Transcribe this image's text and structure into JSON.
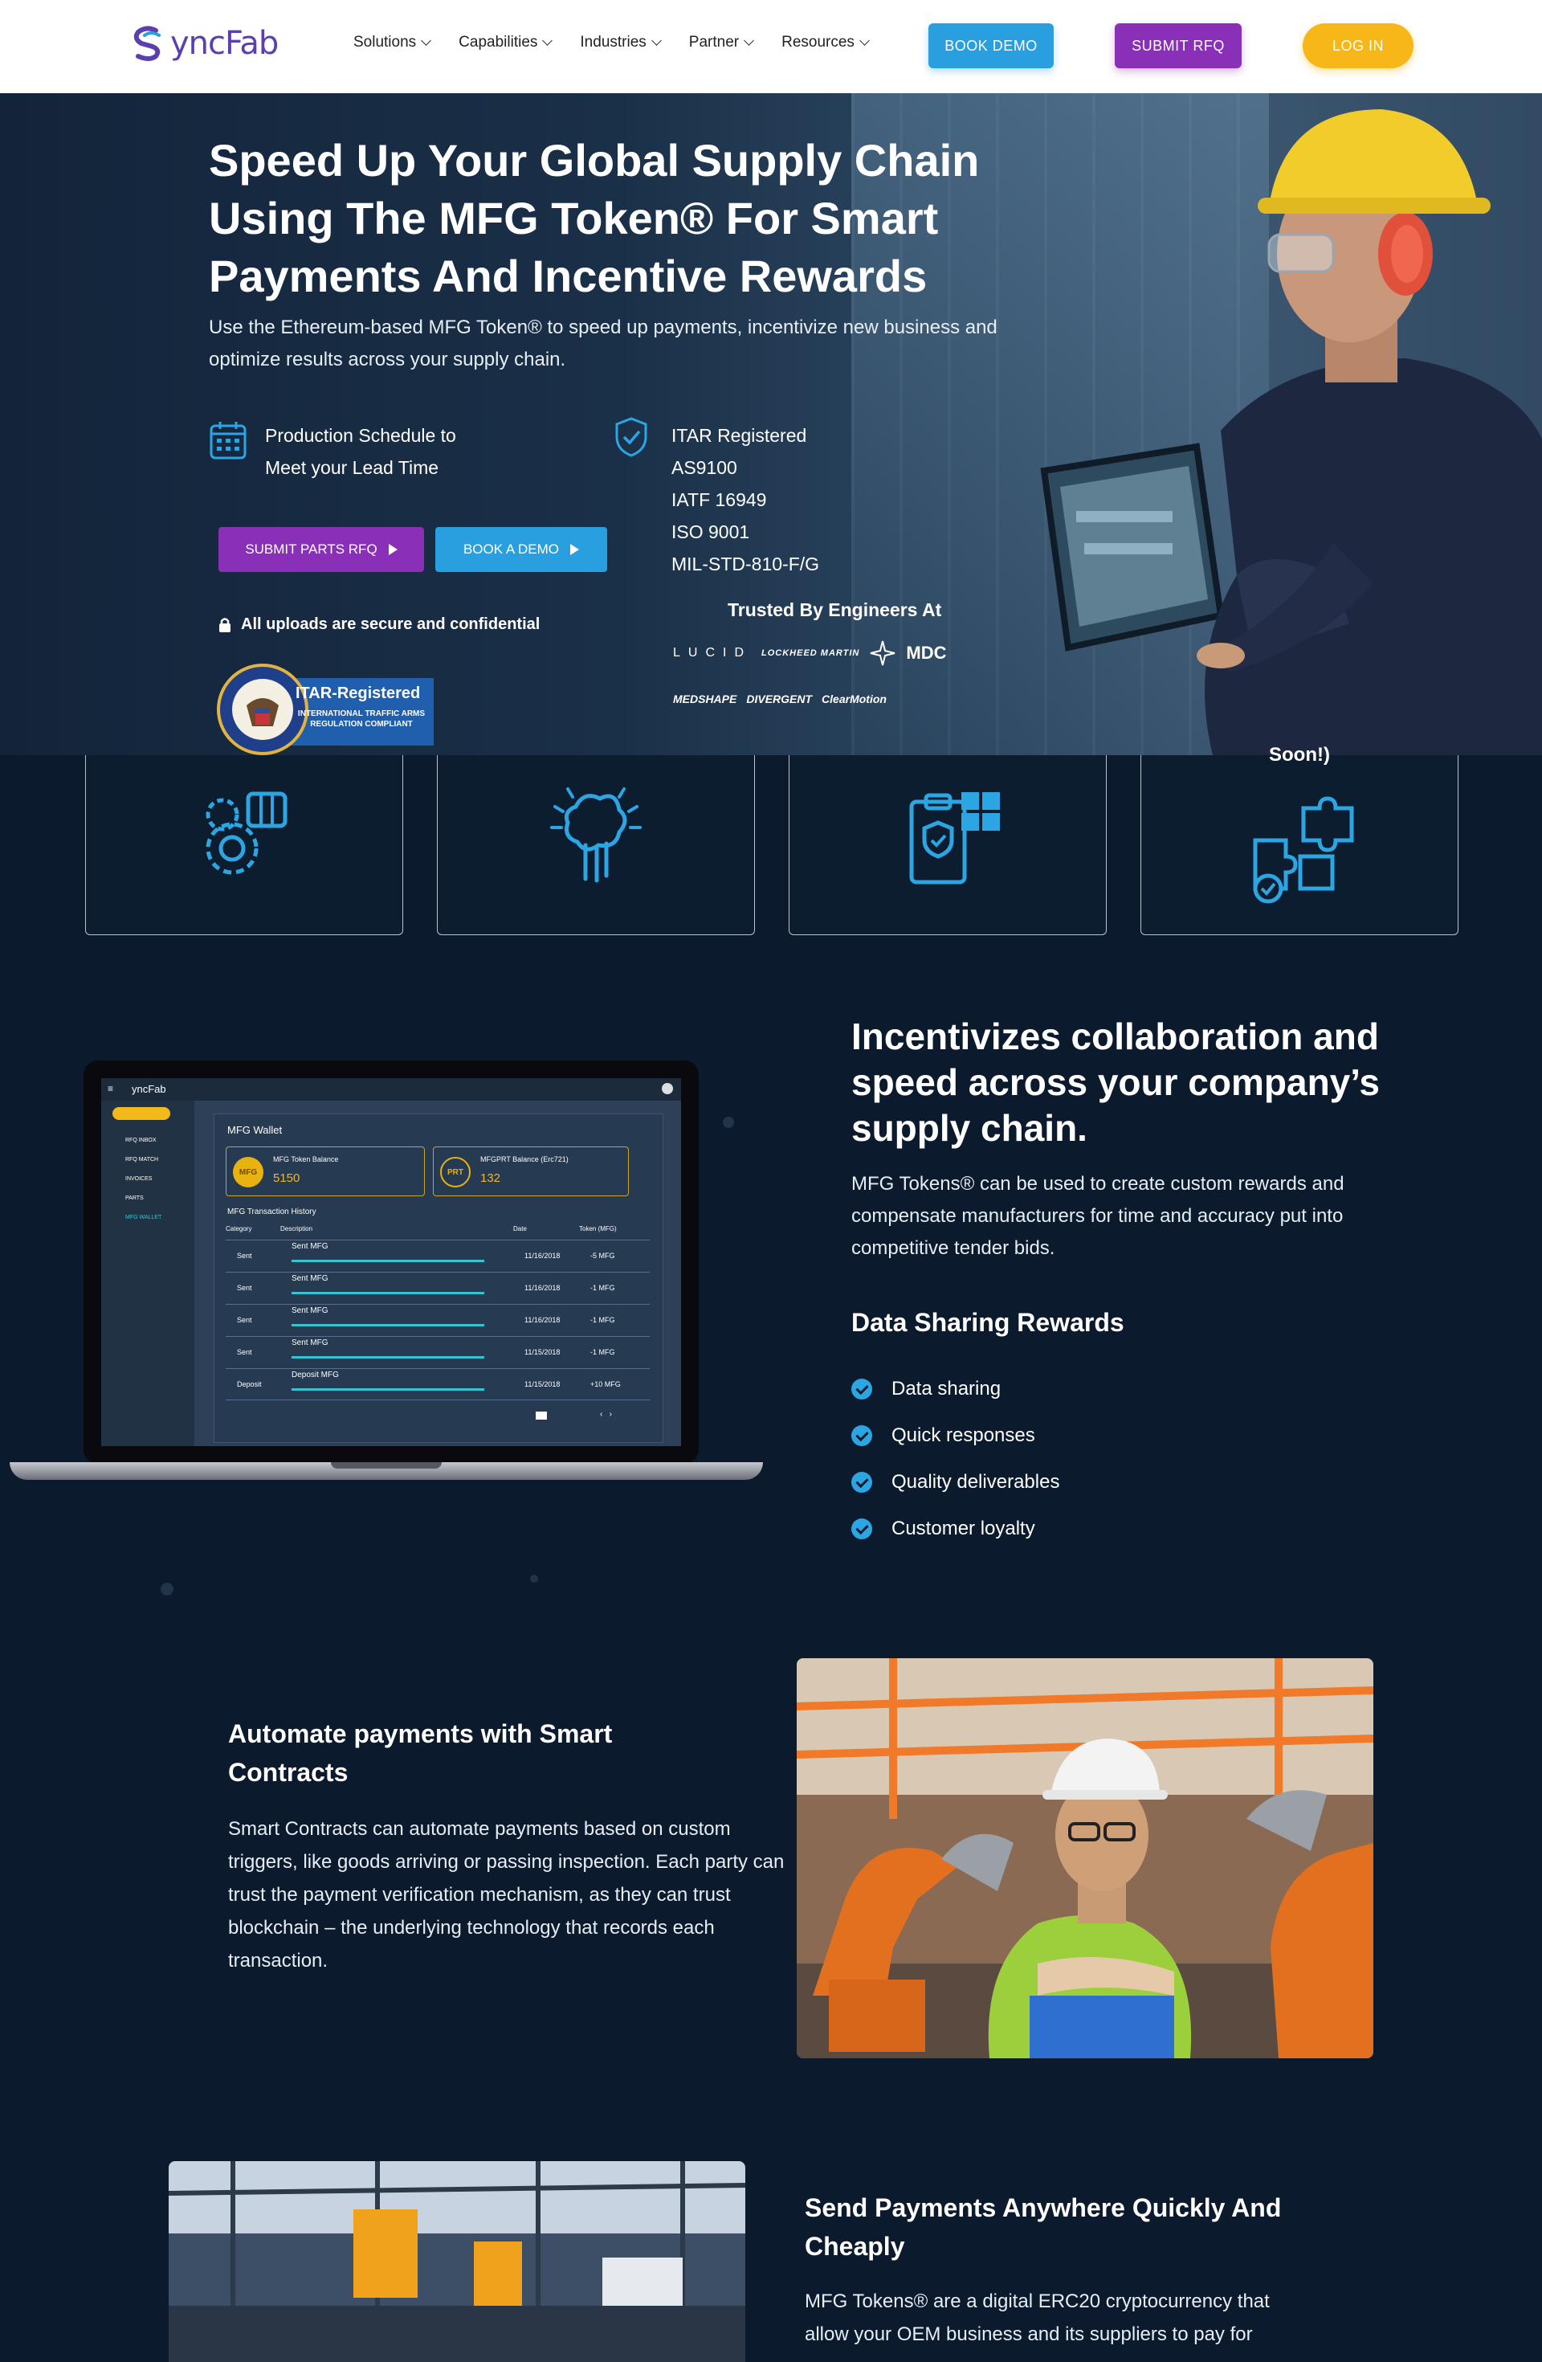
{
  "nav": {
    "logo_text": "yncFab",
    "menu": [
      {
        "label": "Solutions"
      },
      {
        "label": "Capabilities"
      },
      {
        "label": "Industries"
      },
      {
        "label": "Partner"
      },
      {
        "label": "Resources"
      }
    ],
    "book_demo": "BOOK DEMO",
    "submit_rfq": "SUBMIT RFQ",
    "login": "LOG IN"
  },
  "hero": {
    "title": "Speed Up Your Global Supply Chain Using The MFG Token® For Smart Payments And Incentive Rewards",
    "subtitle": "Use the Ethereum-based MFG Token® to speed up payments, incentivize new business and optimize results across your supply chain.",
    "feature_schedule": "Production Schedule to\nMeet your Lead Time",
    "certifications": [
      "ITAR Registered",
      "AS9100",
      "IATF 16949",
      "ISO 9001",
      "MIL-STD-810-F/G"
    ],
    "btn_parts_rfq": "SUBMIT PARTS RFQ",
    "btn_book_demo": "BOOK A DEMO",
    "secure_note": "All uploads are secure and confidential",
    "itar_badge": {
      "title": "ITAR-Registered",
      "subtitle": "INTERNATIONAL TRAFFIC ARMS REGULATION COMPLIANT"
    },
    "trusted_by": "Trusted By Engineers At",
    "logos_row1": [
      "LUCID",
      "LOCKHEED MARTIN",
      "MDC"
    ],
    "logos_row2": [
      "MEDSHAPE",
      "DIVERGENT",
      "ClearMotion"
    ]
  },
  "cards": [
    {
      "text": "",
      "icon": "gear-machine-icon"
    },
    {
      "text": "",
      "icon": "brain-hand-icon"
    },
    {
      "text": "",
      "icon": "clipboard-shield-icon"
    },
    {
      "text": "Soon!)",
      "icon": "puzzle-check-icon"
    }
  ],
  "wallet": {
    "app_logo": "yncFab",
    "sidebar": [
      "",
      "RFQ INBOX",
      "RFQ MATCH",
      "INVOICES",
      "PARTS",
      "MFG WALLET"
    ],
    "title": "MFG Wallet",
    "token_balance_label": "MFG Token Balance",
    "token_balance": "5150",
    "prt_balance_label": "MFGPRT Balance (Erc721)",
    "prt_balance": "132",
    "history_title": "MFG Transaction History",
    "columns": [
      "Category",
      "Description",
      "Date",
      "Token (MFG)"
    ],
    "rows": [
      {
        "category": "Sent",
        "description": "Sent MFG",
        "date": "11/16/2018",
        "amount": "-5 MFG"
      },
      {
        "category": "Sent",
        "description": "Sent MFG",
        "date": "11/16/2018",
        "amount": "-1 MFG"
      },
      {
        "category": "Sent",
        "description": "Sent MFG",
        "date": "11/16/2018",
        "amount": "-1 MFG"
      },
      {
        "category": "Sent",
        "description": "Sent MFG",
        "date": "11/15/2018",
        "amount": "-1 MFG"
      },
      {
        "category": "Deposit",
        "description": "Deposit MFG",
        "date": "11/15/2018",
        "amount": "+10 MFG"
      }
    ]
  },
  "incentive": {
    "title": "Incentivizes collaboration and speed across your company’s supply chain.",
    "body": "MFG Tokens® can be used to create custom rewards and compensate manufacturers for time and accuracy put into competitive tender bids.",
    "rewards_title": "Data Sharing Rewards",
    "rewards": [
      "Data sharing",
      "Quick responses",
      "Quality deliverables",
      "Customer loyalty"
    ]
  },
  "automate": {
    "title": "Automate payments with Smart Contracts",
    "body": "Smart Contracts can automate payments based on custom triggers, like goods arriving or passing inspection. Each party can trust the payment verification mechanism, as they can trust blockchain – the underlying technology that records each transaction."
  },
  "send": {
    "title": "Send Payments Anywhere Quickly And Cheaply",
    "body": "MFG Tokens® are a digital ERC20 cryptocurrency that allow your OEM business and its suppliers to pay for"
  },
  "colors": {
    "page_bg": "#0b1a2c",
    "brand_purple": "#8a2fb8",
    "brand_blue": "#2a9fe0",
    "login_yellow": "#f7b719",
    "check_blue": "#2ba6e3"
  }
}
